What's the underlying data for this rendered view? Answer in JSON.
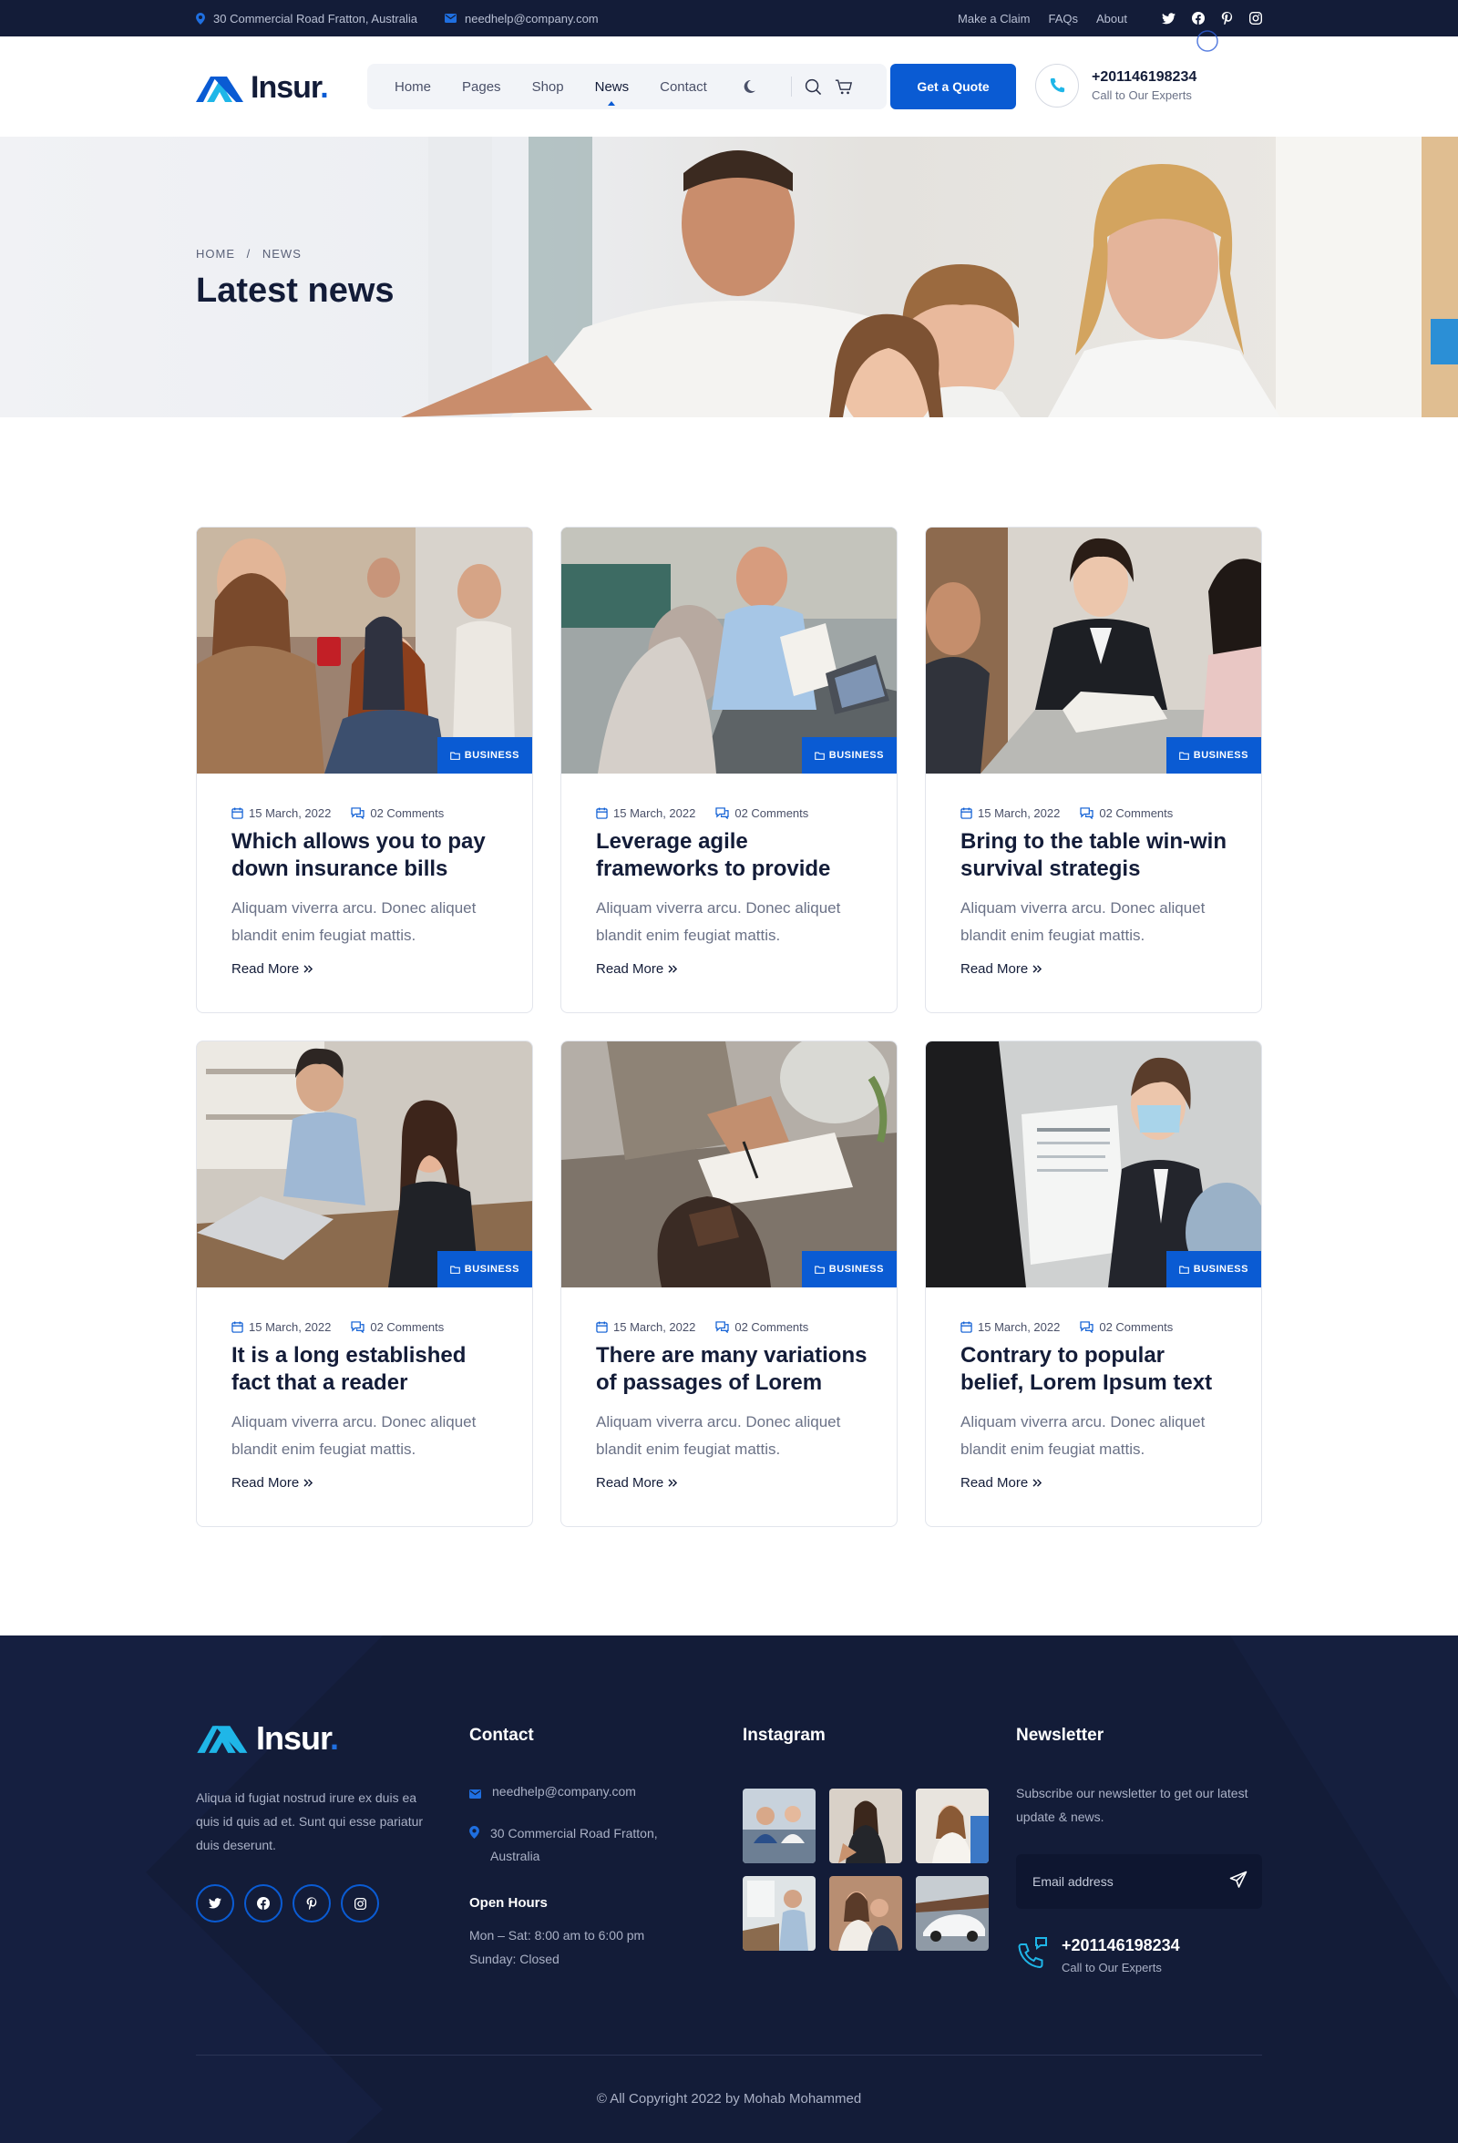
{
  "topbar": {
    "address": "30 Commercial Road Fratton, Australia",
    "email": "needhelp@company.com",
    "links": [
      "Make a Claim",
      "FAQs",
      "About"
    ]
  },
  "header": {
    "logo": "Insur",
    "nav": [
      "Home",
      "Pages",
      "Shop",
      "News",
      "Contact"
    ],
    "active_nav": "News",
    "quote_button": "Get a Quote",
    "phone": "+201146198234",
    "phone_sub": "Call to Our Experts"
  },
  "hero": {
    "breadcrumb_home": "HOME",
    "breadcrumb_sep": "/",
    "breadcrumb_current": "NEWS",
    "title": "Latest news"
  },
  "posts": [
    {
      "category": "BUSINESS",
      "date": "15 March, 2022",
      "comments": "02 Comments",
      "title": "Which allows you to pay down insurance bills",
      "excerpt": "Aliquam viverra arcu. Donec aliquet blandit enim feugiat mattis.",
      "more": "Read More"
    },
    {
      "category": "BUSINESS",
      "date": "15 March, 2022",
      "comments": "02 Comments",
      "title": "Leverage agile frameworks to provide",
      "excerpt": "Aliquam viverra arcu. Donec aliquet blandit enim feugiat mattis.",
      "more": "Read More"
    },
    {
      "category": "BUSINESS",
      "date": "15 March, 2022",
      "comments": "02 Comments",
      "title": "Bring to the table win-win survival strategis",
      "excerpt": "Aliquam viverra arcu. Donec aliquet blandit enim feugiat mattis.",
      "more": "Read More"
    },
    {
      "category": "BUSINESS",
      "date": "15 March, 2022",
      "comments": "02 Comments",
      "title": "It is a long established fact that a reader",
      "excerpt": "Aliquam viverra arcu. Donec aliquet blandit enim feugiat mattis.",
      "more": "Read More"
    },
    {
      "category": "BUSINESS",
      "date": "15 March, 2022",
      "comments": "02 Comments",
      "title": "There are many variations of passages of Lorem",
      "excerpt": "Aliquam viverra arcu. Donec aliquet blandit enim feugiat mattis.",
      "more": "Read More"
    },
    {
      "category": "BUSINESS",
      "date": "15 March, 2022",
      "comments": "02 Comments",
      "title": "Contrary to popular belief, Lorem Ipsum text",
      "excerpt": "Aliquam viverra arcu. Donec aliquet blandit enim feugiat mattis.",
      "more": "Read More"
    }
  ],
  "footer": {
    "logo": "Insur",
    "about": "Aliqua id fugiat nostrud irure ex duis ea quis id quis ad et. Sunt qui esse pariatur duis deserunt.",
    "contact_title": "Contact",
    "email": "needhelp@company.com",
    "address": "30 Commercial Road Fratton, Australia",
    "hours_title": "Open Hours",
    "hours_weekday": "Mon – Sat: 8:00 am to 6:00 pm",
    "hours_sunday": "Sunday: Closed",
    "instagram_title": "Instagram",
    "newsletter_title": "Newsletter",
    "newsletter_text": "Subscribe our newsletter to get our latest update & news.",
    "email_placeholder": "Email address",
    "phone": "+201146198234",
    "phone_sub": "Call to Our Experts",
    "copyright": "© All Copyright 2022 by Mohab Mohammed"
  },
  "colors": {
    "navy": "#131c38",
    "brand_blue": "#0a5bd3",
    "accent_cyan": "#1fb6e8"
  },
  "icons": [
    "location-icon",
    "mail-icon",
    "twitter-icon",
    "facebook-icon",
    "pinterest-icon",
    "instagram-icon",
    "moon-icon",
    "search-icon",
    "cart-icon",
    "phone-icon",
    "folder-icon",
    "calendar-icon",
    "comment-icon",
    "double-chevron-icon",
    "send-icon"
  ]
}
